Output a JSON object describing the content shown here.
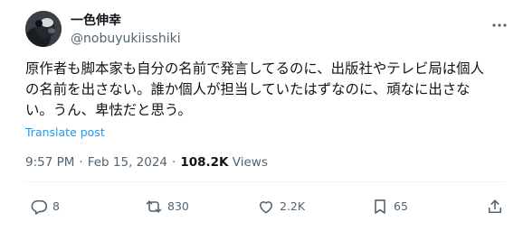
{
  "author": {
    "display_name": "一色伸幸",
    "handle": "@nobuyukiisshiki",
    "avatar_icon": "avatar-dog-photo"
  },
  "tweet": {
    "lines": [
      "原作者も脚本家も自分の名前で発言してるのに、出版社やテレビ局は個人",
      "の名前を出さない。誰か個人が担当していたはずなのに、頑なに出さな",
      "い。うん、卑怯だと思う。"
    ],
    "translate_label": "Translate post"
  },
  "meta": {
    "time": "9:57 PM",
    "separator": "·",
    "date": "Feb 15, 2024",
    "views_count": "108.2K",
    "views_label": "Views"
  },
  "actions": {
    "reply": {
      "icon": "reply-icon",
      "count": "8"
    },
    "repost": {
      "icon": "repost-icon",
      "count": "830"
    },
    "like": {
      "icon": "heart-icon",
      "count": "2.2K"
    },
    "bookmark": {
      "icon": "bookmark-icon",
      "count": "65"
    },
    "share": {
      "icon": "share-icon"
    }
  },
  "colors": {
    "text": "#0f1419",
    "secondary": "#536471",
    "link": "#1d9bf0",
    "divider": "#eff3f4"
  }
}
